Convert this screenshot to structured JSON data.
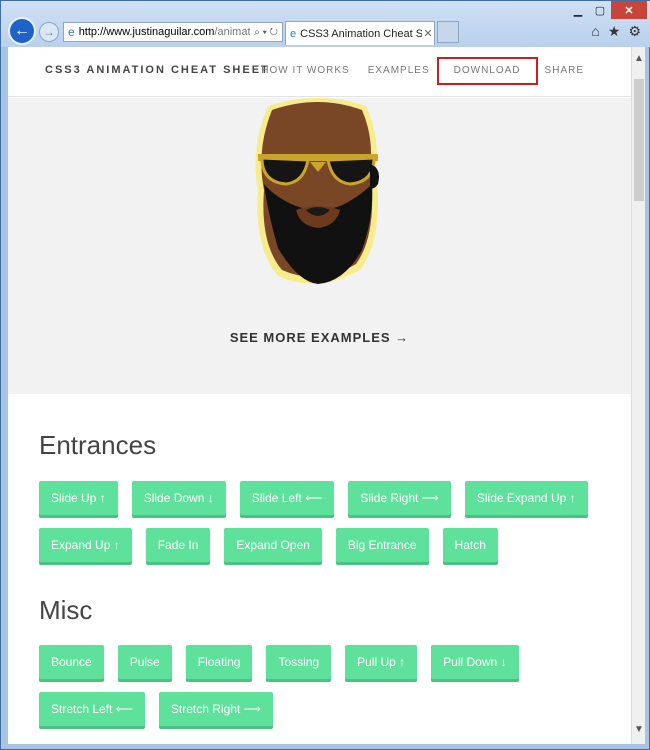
{
  "browser": {
    "url_domain": "http://www.justinaguilar.com",
    "url_path": "/animat",
    "address_tools": "⌕ ▾ ↻",
    "tab_title": "CSS3 Animation Cheat Sh...",
    "tab_close": "✕",
    "back_glyph": "←",
    "forward_glyph": "→",
    "home_glyph": "⌂",
    "star_glyph": "★",
    "gear_glyph": "⚙"
  },
  "site": {
    "brand": "CSS3 ANIMATION CHEAT SHEET",
    "nav": [
      "HOW IT WORKS",
      "EXAMPLES",
      "DOWNLOAD",
      "SHARE"
    ],
    "see_more": "SEE MORE EXAMPLES →"
  },
  "sections": {
    "entrances": {
      "title": "Entrances",
      "row1": [
        "Slide Up ↑",
        "Slide Down ↓",
        "Slide Left ⟵",
        "Slide Right ⟶",
        "Slide Expand Up ↑"
      ],
      "row2": [
        "Expand Up ↑",
        "Fade In",
        "Expand Open",
        "Big Entrance",
        "Hatch"
      ]
    },
    "misc": {
      "title": "Misc",
      "row1": [
        "Bounce",
        "Pulse",
        "Floating",
        "Tossing",
        "Pull Up ↑",
        "Pull Down ↓"
      ],
      "row2": [
        "Stretch Left ⟵",
        "Stretch Right ⟶"
      ]
    }
  },
  "colors": {
    "button": "#5ee29b",
    "highlight": "#d21b1b"
  }
}
